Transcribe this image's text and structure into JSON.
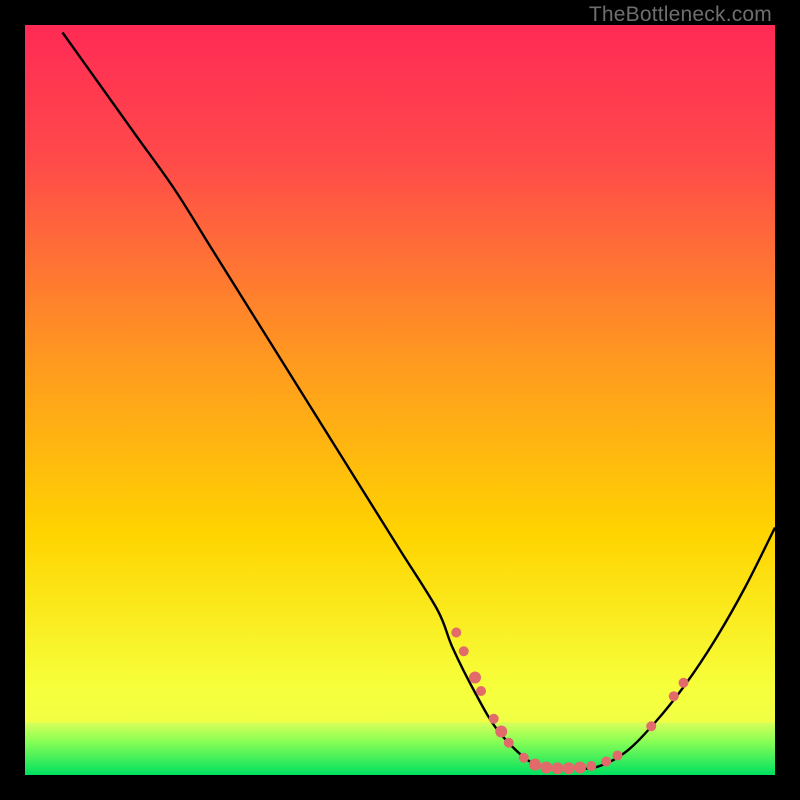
{
  "watermark": "TheBottleneck.com",
  "colors": {
    "gradient_top": "#ff2a55",
    "gradient_mid": "#ffd400",
    "gradient_bottom": "#00e060",
    "green_band_top": "#d8ff5a",
    "green_band_bottom": "#00ff66",
    "curve": "#000000",
    "marker_fill": "#e26a6a",
    "marker_stroke": "#aa4a4a",
    "frame": "#000000"
  },
  "chart_data": {
    "type": "line",
    "title": "",
    "xlabel": "",
    "ylabel": "",
    "xlim": [
      0,
      100
    ],
    "ylim": [
      0,
      100
    ],
    "curve": {
      "x": [
        5,
        10,
        15,
        20,
        25,
        30,
        35,
        40,
        45,
        50,
        55,
        57,
        60,
        63,
        67,
        70,
        73,
        76,
        80,
        84,
        88,
        92,
        96,
        100
      ],
      "y": [
        99,
        92,
        85,
        78,
        70,
        62,
        54,
        46,
        38,
        30,
        22,
        17,
        11,
        6,
        2,
        1,
        1,
        1,
        3,
        7,
        12,
        18,
        25,
        33
      ]
    },
    "markers": [
      {
        "x": 57.5,
        "y": 19.0,
        "r": 5
      },
      {
        "x": 58.5,
        "y": 16.5,
        "r": 5
      },
      {
        "x": 60.0,
        "y": 13.0,
        "r": 6
      },
      {
        "x": 60.8,
        "y": 11.2,
        "r": 5
      },
      {
        "x": 62.5,
        "y": 7.5,
        "r": 5
      },
      {
        "x": 63.5,
        "y": 5.8,
        "r": 6
      },
      {
        "x": 64.5,
        "y": 4.3,
        "r": 5
      },
      {
        "x": 66.5,
        "y": 2.3,
        "r": 5
      },
      {
        "x": 68.0,
        "y": 1.4,
        "r": 6
      },
      {
        "x": 69.5,
        "y": 1.0,
        "r": 6
      },
      {
        "x": 71.0,
        "y": 0.9,
        "r": 6
      },
      {
        "x": 72.5,
        "y": 0.9,
        "r": 6
      },
      {
        "x": 74.0,
        "y": 1.0,
        "r": 6
      },
      {
        "x": 75.5,
        "y": 1.2,
        "r": 5
      },
      {
        "x": 77.5,
        "y": 1.8,
        "r": 5
      },
      {
        "x": 79.0,
        "y": 2.6,
        "r": 5
      },
      {
        "x": 83.5,
        "y": 6.5,
        "r": 5
      },
      {
        "x": 86.5,
        "y": 10.5,
        "r": 5
      },
      {
        "x": 87.8,
        "y": 12.3,
        "r": 5
      }
    ],
    "green_band": {
      "y_top": 7,
      "y_bottom": 0
    }
  }
}
